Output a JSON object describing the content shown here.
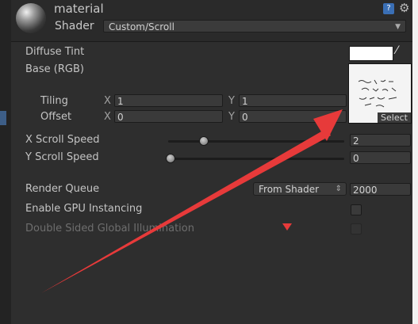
{
  "header": {
    "material_name": "material",
    "shader_label": "Shader",
    "shader_value": "Custom/Scroll",
    "help_icon": "help-icon",
    "gear_icon": "gear-icon"
  },
  "properties": {
    "diffuse_tint_label": "Diffuse Tint",
    "diffuse_tint_color": "#ffffff",
    "base_label": "Base (RGB)",
    "select_label": "Select",
    "tiling_label": "Tiling",
    "offset_label": "Offset",
    "tiling": {
      "x_axis": "X",
      "x": "1",
      "y_axis": "Y",
      "y": "1"
    },
    "offset": {
      "x_axis": "X",
      "x": "0",
      "y_axis": "Y",
      "y": "0"
    },
    "x_scroll_speed_label": "X Scroll Speed",
    "x_scroll_speed_value": "2",
    "y_scroll_speed_label": "Y Scroll Speed",
    "y_scroll_speed_value": "0",
    "render_queue_label": "Render Queue",
    "render_queue_mode": "From Shader",
    "render_queue_value": "2000",
    "gpu_instancing_label": "Enable GPU Instancing",
    "double_sided_gi_label": "Double Sided Global Illumination"
  },
  "colors": {
    "annotation_arrow": "#e73a3a",
    "panel_background": "#2e2e2e"
  }
}
